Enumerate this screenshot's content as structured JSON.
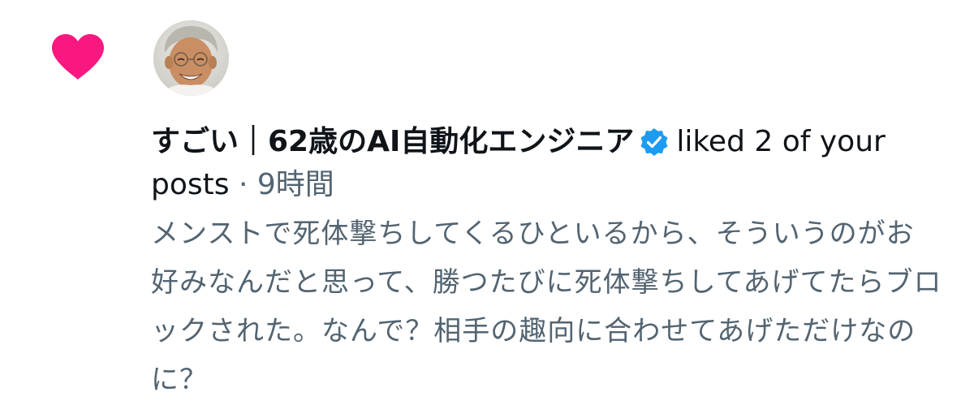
{
  "notification": {
    "type_icon": "heart-icon",
    "like_color": "#f91880",
    "verified_color": "#1d9bf0",
    "avatar_icon": "user-avatar-photo",
    "user_name": "すごい｜62歳のAI自動化エンジニア",
    "action_text": "liked 2 of your posts",
    "separator": " · ",
    "time": "9時間",
    "post_preview": "メンストで死体撃ちしてくるひといるから、そういうのがお好みなんだと思って、勝つたびに死体撃ちしてあげてたらブロックされた。なんで？相手の趣向に合わせてあげただけなのに？"
  }
}
